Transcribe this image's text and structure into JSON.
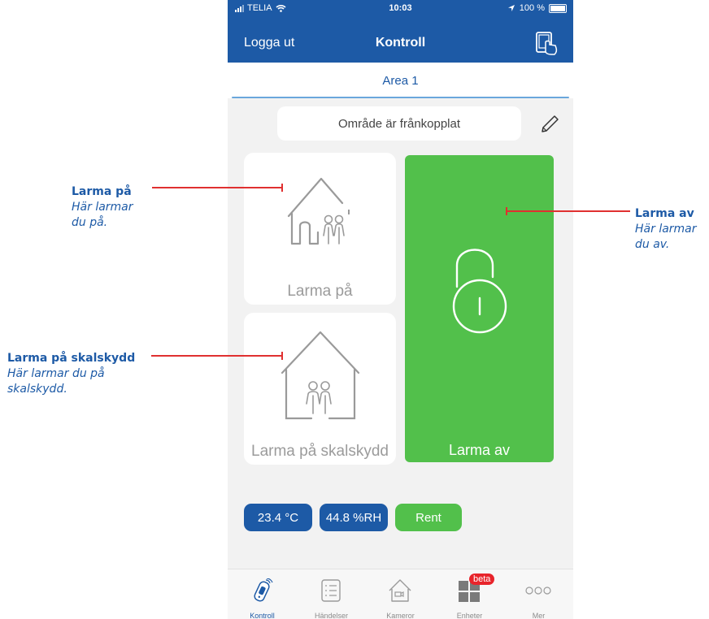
{
  "status_bar": {
    "carrier": "TELIA",
    "time": "10:03",
    "battery": "100 %"
  },
  "nav": {
    "logout": "Logga ut",
    "title": "Kontroll",
    "tablet_icon": "tablet-touch-icon"
  },
  "area": {
    "name": "Area 1"
  },
  "status_text": "Område är frånkopplat",
  "tiles": {
    "arm_on": {
      "label": "Larma på",
      "icon": "house-family-icon"
    },
    "arm_shell": {
      "label": "Larma på skalskydd",
      "icon": "house-family-inside-icon"
    },
    "disarm": {
      "label": "Larma av",
      "icon": "unlocked-padlock-icon"
    }
  },
  "sensors": {
    "temperature": "23.4 °C",
    "humidity": "44.8 %RH",
    "air": "Rent"
  },
  "tabs": [
    {
      "label": "Kontroll",
      "icon": "remote-control-icon",
      "active": true
    },
    {
      "label": "Händelser",
      "icon": "event-list-icon",
      "active": false
    },
    {
      "label": "Kameror",
      "icon": "camera-house-icon",
      "active": false
    },
    {
      "label": "Enheter",
      "icon": "devices-grid-icon",
      "active": false,
      "badge": "beta"
    },
    {
      "label": "Mer",
      "icon": "more-dots-icon",
      "active": false
    }
  ],
  "annotations": {
    "arm_on": {
      "title": "Larma på",
      "desc_line1": "Här larmar",
      "desc_line2": "du på."
    },
    "arm_shell": {
      "title": "Larma på skalskydd",
      "desc_line1": "Här larmar du på",
      "desc_line2": "skalskydd."
    },
    "disarm": {
      "title": "Larma av",
      "desc_line1": "Här larmar",
      "desc_line2": "du av."
    }
  },
  "colors": {
    "brand_blue": "#1d5aa6",
    "green": "#52c04b",
    "annotation_red": "#e03030",
    "badge_red": "#e8242b"
  }
}
